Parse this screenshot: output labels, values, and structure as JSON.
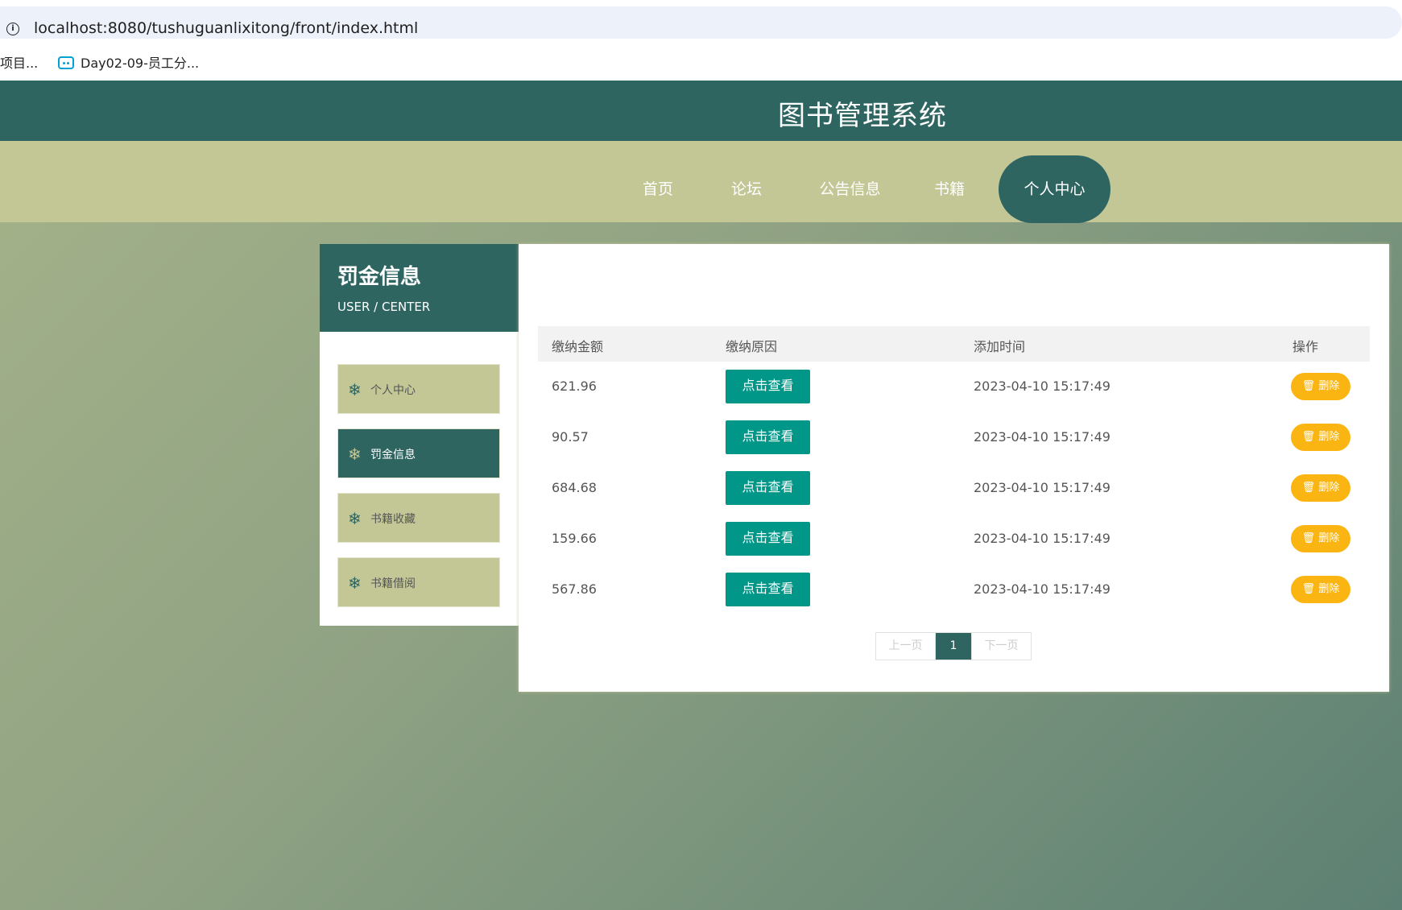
{
  "browser": {
    "url": "localhost:8080/tushuguanlixitong/front/index.html",
    "bookmarks": [
      "项目...",
      "Day02-09-员工分..."
    ]
  },
  "header": {
    "title": "图书管理系统"
  },
  "nav": {
    "items": [
      "首页",
      "论坛",
      "公告信息",
      "书籍",
      "个人中心"
    ],
    "active": "个人中心"
  },
  "sidebar": {
    "title": "罚金信息",
    "subtitle": "USER / CENTER",
    "items": [
      "个人中心",
      "罚金信息",
      "书籍收藏",
      "书籍借阅"
    ],
    "active": "罚金信息"
  },
  "table": {
    "columns": [
      "缴纳金额",
      "缴纳原因",
      "添加时间",
      "操作"
    ],
    "rows": [
      {
        "amount": "621.96",
        "reason": "点击查看",
        "time": "2023-04-10 15:17:49",
        "action": "删除"
      },
      {
        "amount": "90.57",
        "reason": "点击查看",
        "time": "2023-04-10 15:17:49",
        "action": "删除"
      },
      {
        "amount": "684.68",
        "reason": "点击查看",
        "time": "2023-04-10 15:17:49",
        "action": "删除"
      },
      {
        "amount": "159.66",
        "reason": "点击查看",
        "time": "2023-04-10 15:17:49",
        "action": "删除"
      },
      {
        "amount": "567.86",
        "reason": "点击查看",
        "time": "2023-04-10 15:17:49",
        "action": "删除"
      }
    ]
  },
  "pagination": {
    "prev": "上一页",
    "current": "1",
    "next": "下一页"
  },
  "colors": {
    "primary": "#2e6561",
    "secondary": "#c3c796",
    "view_button": "#009688",
    "delete_button": "#fbb512"
  },
  "icons": {
    "info": "info-icon",
    "bookmark": "bilibili-icon",
    "sidebar": "snowflake-icon",
    "delete": "trash-icon"
  }
}
